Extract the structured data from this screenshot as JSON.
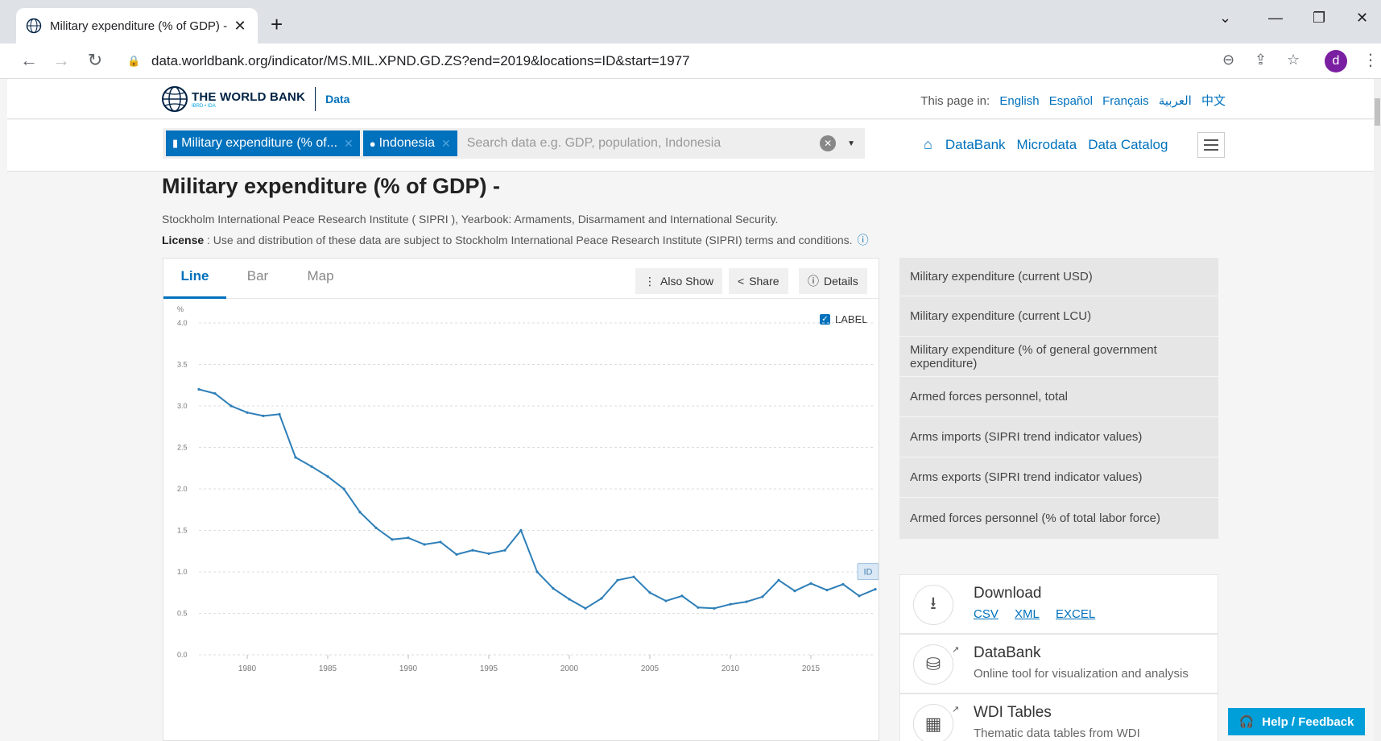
{
  "browser": {
    "tab_title": "Military expenditure (% of GDP) -",
    "url": "data.worldbank.org/indicator/MS.MIL.XPND.GD.ZS?end=2019&locations=ID&start=1977",
    "avatar_letter": "d"
  },
  "header": {
    "brand": "THE WORLD BANK",
    "brand_sub": "IBRD • IDA",
    "section": "Data",
    "lang_prefix": "This page in:",
    "languages": [
      "English",
      "Español",
      "Français",
      "العربية",
      "中文"
    ]
  },
  "search": {
    "chips": [
      "Military expenditure (% of...",
      "Indonesia"
    ],
    "placeholder": "Search data e.g. GDP, population, Indonesia"
  },
  "nav_links": [
    "DataBank",
    "Microdata",
    "Data Catalog"
  ],
  "page": {
    "title": "Military expenditure (% of GDP) -",
    "source": "Stockholm International Peace Research Institute ( SIPRI ), Yearbook: Armaments, Disarmament and International Security.",
    "license_label": "License",
    "license_text": " : Use and distribution of these data are subject to Stockholm International Peace Research Institute (SIPRI) terms and conditions."
  },
  "chart_panel": {
    "tabs": [
      "Line",
      "Bar",
      "Map"
    ],
    "active_tab": "Line",
    "buttons": [
      "Also Show",
      "Share",
      "Details"
    ],
    "label_toggle": "LABEL"
  },
  "chart_data": {
    "type": "line",
    "ylabel": "%",
    "ylim": [
      0,
      4.0
    ],
    "yticks": [
      "0.0",
      "0.5",
      "1.0",
      "1.5",
      "2.0",
      "2.5",
      "3.0",
      "3.5",
      "4.0"
    ],
    "xticks": [
      "1980",
      "1985",
      "1990",
      "1995",
      "2000",
      "2005",
      "2010",
      "2015"
    ],
    "grid": true,
    "series": [
      {
        "name": "ID",
        "color": "#2e7fb8",
        "x": [
          1977,
          1978,
          1979,
          1980,
          1981,
          1982,
          1983,
          1984,
          1985,
          1986,
          1987,
          1988,
          1989,
          1990,
          1991,
          1992,
          1993,
          1994,
          1995,
          1996,
          1997,
          1998,
          1999,
          2000,
          2001,
          2002,
          2003,
          2004,
          2005,
          2006,
          2007,
          2008,
          2009,
          2010,
          2011,
          2012,
          2013,
          2014,
          2015,
          2016,
          2017,
          2018,
          2019
        ],
        "values": [
          3.2,
          3.15,
          3.0,
          2.92,
          2.88,
          2.9,
          2.38,
          2.27,
          2.15,
          2.0,
          1.72,
          1.53,
          1.39,
          1.41,
          1.33,
          1.36,
          1.21,
          1.26,
          1.22,
          1.26,
          1.5,
          1.0,
          0.8,
          0.67,
          0.56,
          0.68,
          0.9,
          0.94,
          0.75,
          0.65,
          0.71,
          0.57,
          0.56,
          0.61,
          0.64,
          0.7,
          0.9,
          0.77,
          0.86,
          0.78,
          0.85,
          0.71,
          0.79
        ]
      }
    ]
  },
  "related": [
    "Military expenditure (current USD)",
    "Military expenditure (current LCU)",
    "Military expenditure (% of general government expenditure)",
    "Armed forces personnel, total",
    "Arms imports (SIPRI trend indicator values)",
    "Arms exports (SIPRI trend indicator values)",
    "Armed forces personnel (% of total labor force)"
  ],
  "download": {
    "title": "Download",
    "formats": [
      "CSV",
      "XML",
      "EXCEL"
    ]
  },
  "databank": {
    "title": "DataBank",
    "desc": "Online tool for visualization and analysis"
  },
  "wdi": {
    "title": "WDI Tables",
    "desc": "Thematic data tables from WDI"
  },
  "help_label": "Help / Feedback"
}
